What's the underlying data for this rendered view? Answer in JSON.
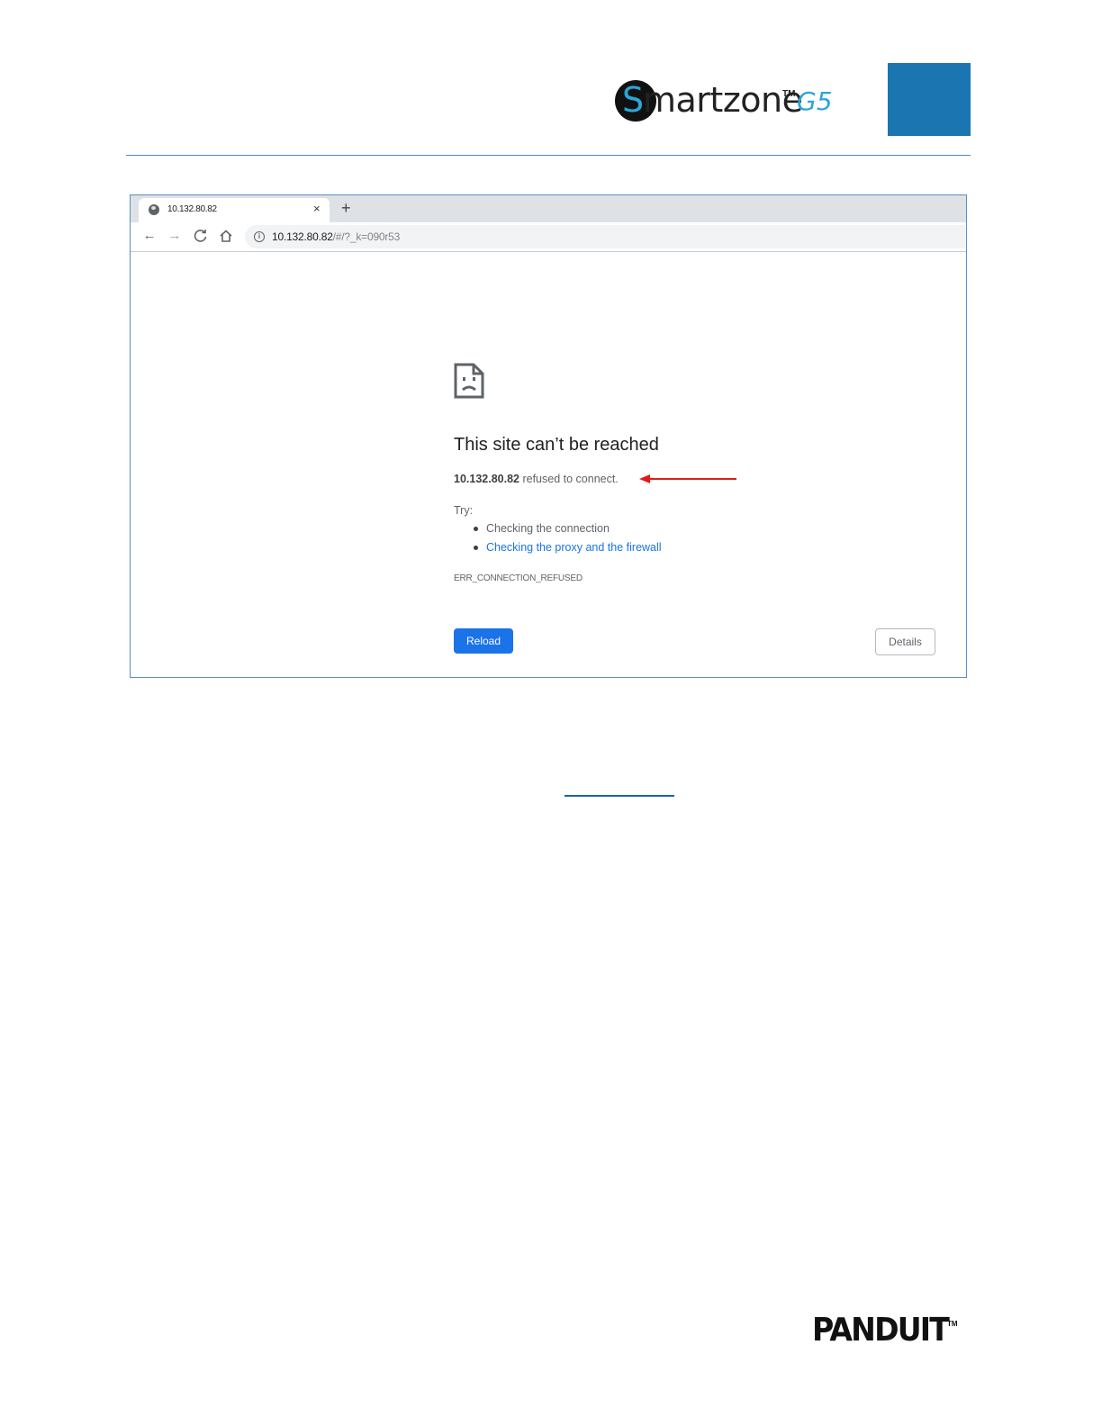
{
  "header": {
    "logo": {
      "s": "S",
      "rest": "martzone",
      "tm": "TM",
      "g5": "G5"
    },
    "accent_color": "#1b75b0"
  },
  "browser": {
    "tab": {
      "title": "10.132.80.82",
      "close": "×",
      "icon": "globe-icon"
    },
    "new_tab": "+",
    "toolbar": {
      "back": "←",
      "forward": "→",
      "reload": "C",
      "home": "⌂",
      "info": "i",
      "url_host": "10.132.80.82",
      "url_rest": "/#/?_k=090r53"
    },
    "error": {
      "title": "This site can’t be reached",
      "host": "10.132.80.82",
      "message": " refused to connect.",
      "try_label": "Try:",
      "suggestions": [
        "Checking the connection",
        "Checking the proxy and the firewall"
      ],
      "code": "ERR_CONNECTION_REFUSED",
      "reload_label": "Reload",
      "details_label": "Details"
    },
    "link_color": "#1a73e8",
    "button_color": "#1a73e8",
    "annotation_color": "#e01b1b"
  },
  "footer": {
    "logo_text": "PANDUIT",
    "tm": "TM"
  }
}
